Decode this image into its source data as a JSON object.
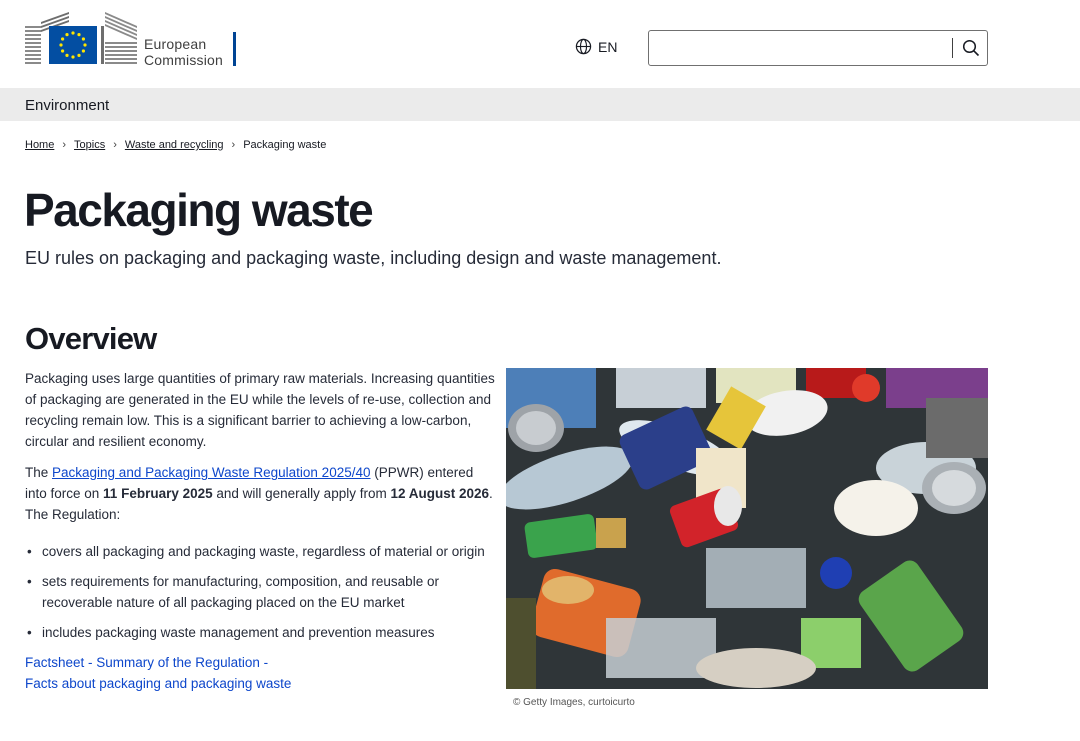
{
  "header": {
    "logo_line1": "European",
    "logo_line2": "Commission",
    "language": "EN",
    "language_icon": "globe-icon",
    "search": {
      "value": "",
      "placeholder": "",
      "icon": "search-icon"
    }
  },
  "site_bar": {
    "title": "Environment"
  },
  "breadcrumb": {
    "items": [
      "Home",
      "Topics",
      "Waste and recycling"
    ],
    "current": "Packaging waste",
    "separator_icon": "chevron-right-icon"
  },
  "page": {
    "title": "Packaging waste",
    "description": "EU rules on packaging and packaging waste, including design and waste management."
  },
  "overview": {
    "heading": "Overview",
    "intro": "Packaging uses large quantities of primary raw materials. Increasing quantities of packaging are generated in the EU while the levels of re-use, collection and recycling remain low.  This is a significant barrier to achieving a low-carbon, circular and resilient economy.",
    "reg_prefix": "The ",
    "reg_link": "Packaging and Packaging Waste Regulation 2025/40",
    "reg_mid1": " (PPWR) entered into force on ",
    "reg_date1": "11 February 2025",
    "reg_mid2": " and will generally apply from ",
    "reg_date2": "12 August 2026",
    "reg_suffix": ". The Regulation:",
    "bullets": [
      "covers all packaging and packaging waste, regardless of material or origin",
      "sets requirements for manufacturing, composition, and reusable or recoverable nature of all packaging placed on the EU market",
      "includes packaging waste management and prevention measures"
    ],
    "link_factsheet": "Factsheet - Summary of the Regulation -",
    "link_facts": "Facts about packaging and packaging waste"
  },
  "image": {
    "subject": "pile of mixed plastic and metal packaging waste",
    "credit": "© Getty Images, curtoicurto"
  },
  "colors": {
    "brand_blue": "#004494",
    "eu_flag_blue": "#034ea2",
    "eu_flag_yellow": "#ffe500",
    "link_blue": "#0e47cb",
    "site_bar_grey": "#ebebeb",
    "title_text": "#171a22"
  }
}
